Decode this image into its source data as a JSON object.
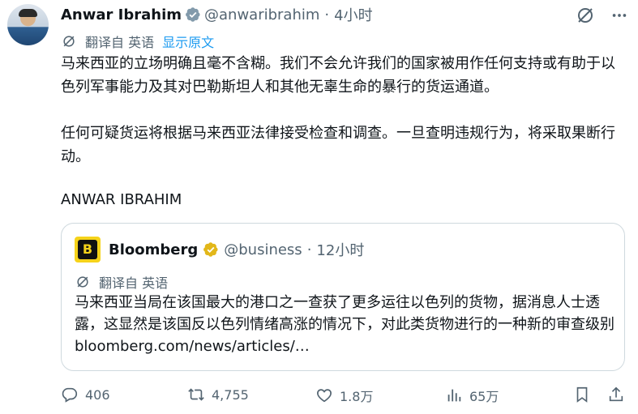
{
  "author": {
    "name": "Anwar Ibrahim",
    "handle": "@anwaribrahim",
    "separator": "·",
    "time": "4小时"
  },
  "translation": {
    "label": "翻译自 英语",
    "show_original": "显示原文"
  },
  "tweet": {
    "paragraph1": "马来西亚的立场明确且毫不含糊。我们不会允许我们的国家被用作任何支持或有助于以色列军事能力及其对巴勒斯坦人和其他无辜生命的暴行的货运通道。",
    "paragraph2": "任何可疑货运将根据马来西亚法律接受检查和调查。一旦查明违规行为，将采取果断行动。",
    "signature": "ANWAR IBRAHIM"
  },
  "quote": {
    "logo_letter": "B",
    "name": "Bloomberg",
    "handle": "@business",
    "separator": "·",
    "time": "12小时",
    "translation_label": "翻译自 英语",
    "text": "马来西亚当局在该国最大的港口之一查获了更多运往以色列的货物，据消息人士透露，这显然是该国反以色列情绪高涨的情况下，对此类货物进行的一种新的审查级别 bloomberg.com/news/articles/…"
  },
  "metrics": {
    "replies": "406",
    "reposts": "4,755",
    "likes": "1.8万",
    "views": "65万"
  },
  "icons": [
    "verified-icon",
    "grok-icon",
    "more-icon",
    "translate-icon",
    "reply-icon",
    "repost-icon",
    "like-icon",
    "views-icon",
    "bookmark-icon",
    "share-icon"
  ],
  "colors": {
    "accent": "#1d9bf0",
    "secondary_text": "#536471",
    "bloomberg_gold": "#f6d31a",
    "verified_blue": "#829aab"
  }
}
